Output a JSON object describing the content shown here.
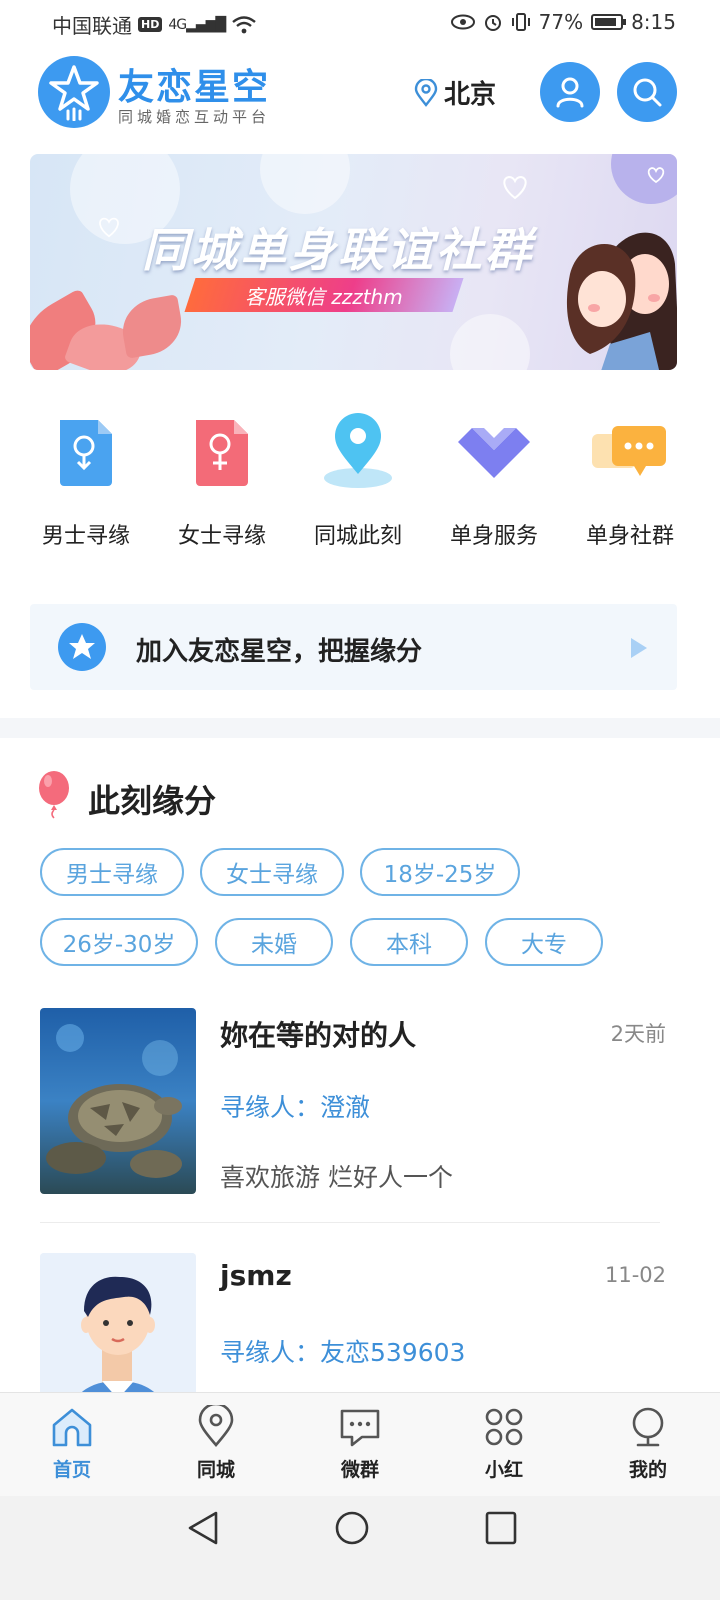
{
  "status_bar": {
    "carrier": "中国联通",
    "network_badge": "HD",
    "signal_text": "4G",
    "battery_percent": "77%",
    "time": "8:15"
  },
  "header": {
    "app_name": "友恋星空",
    "slogan": "同城婚恋互动平台",
    "city": "北京",
    "icons": [
      "location-pin-icon",
      "user-icon",
      "search-icon"
    ],
    "accent_color": "#3d9af0"
  },
  "banner": {
    "title": "同城单身联谊社群",
    "subtitle": "客服微信 zzzthm"
  },
  "quick_menu": [
    {
      "label": "男士寻缘",
      "icon": "male-doc-icon",
      "color": "#4aa3f0"
    },
    {
      "label": "女士寻缘",
      "icon": "female-doc-icon",
      "color": "#f36b78"
    },
    {
      "label": "同城此刻",
      "icon": "map-pin-icon",
      "color": "#4ec3f2"
    },
    {
      "label": "单身服务",
      "icon": "heart-diamond-icon",
      "color": "#7d7ff0"
    },
    {
      "label": "单身社群",
      "icon": "chat-bubbles-icon",
      "color": "#fbb23f"
    }
  ],
  "join_bar": {
    "text": "加入友恋星空，把握缘分"
  },
  "section": {
    "title": "此刻缘分",
    "filters": [
      "男士寻缘",
      "女士寻缘",
      "18岁-25岁",
      "26岁-30岁",
      "未婚",
      "本科",
      "大专"
    ]
  },
  "listings": [
    {
      "title": "妳在等的对的人",
      "time": "2天前",
      "seeker": "寻缘人：澄澈",
      "desc": "喜欢旅游 烂好人一个"
    },
    {
      "title": "jsmz",
      "time": "11-02",
      "seeker": "寻缘人：友恋539603",
      "desc": ""
    }
  ],
  "tab_bar": [
    {
      "label": "首页",
      "icon": "home-icon",
      "active": true
    },
    {
      "label": "同城",
      "icon": "location-icon",
      "active": false
    },
    {
      "label": "微群",
      "icon": "chat-icon",
      "active": false
    },
    {
      "label": "小红",
      "icon": "grid-icon",
      "active": false
    },
    {
      "label": "我的",
      "icon": "profile-icon",
      "active": false
    }
  ]
}
